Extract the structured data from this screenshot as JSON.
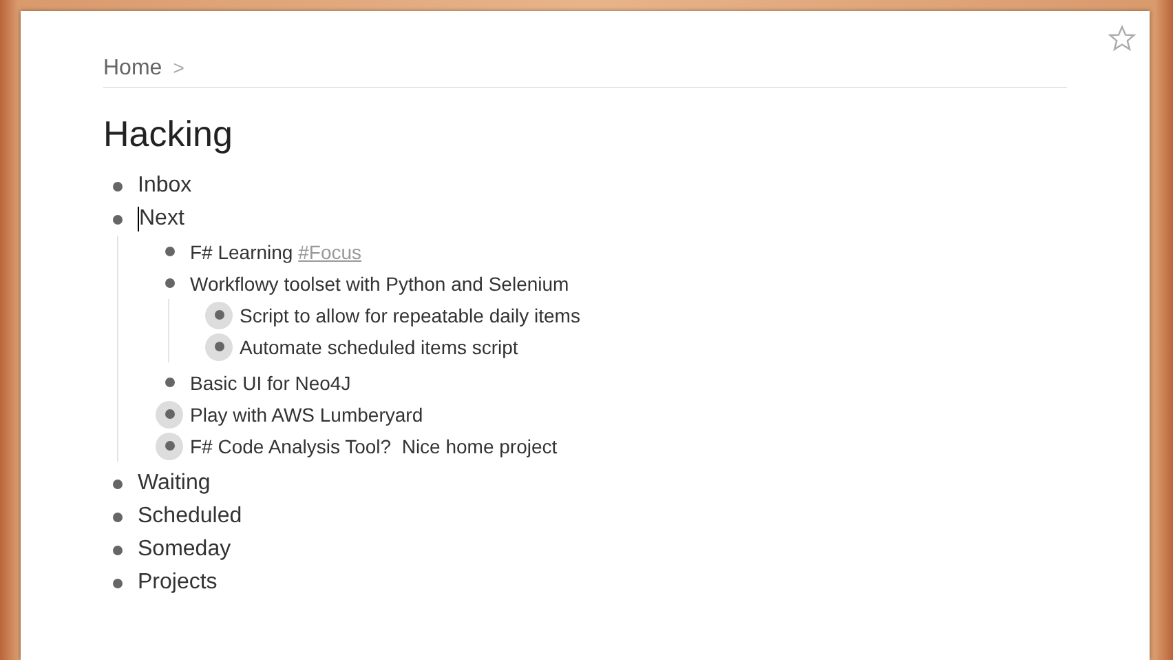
{
  "breadcrumb": [
    {
      "label": "Home"
    }
  ],
  "breadcrumb_separator": ">",
  "starred": false,
  "title": "Hacking",
  "items": [
    {
      "text": "Inbox",
      "collapsed": false,
      "editing": false
    },
    {
      "text": "Next",
      "collapsed": false,
      "editing": true,
      "children": [
        {
          "text": "F# Learning ",
          "tag": "#Focus",
          "collapsed": false,
          "editing": false
        },
        {
          "text": "Workflowy toolset with Python and Selenium",
          "collapsed": false,
          "editing": false,
          "children": [
            {
              "text": "Script to allow for repeatable daily items",
              "collapsed": true,
              "editing": false
            },
            {
              "text": "Automate scheduled items script",
              "collapsed": true,
              "editing": false
            }
          ]
        },
        {
          "text": "Basic UI for Neo4J",
          "collapsed": false,
          "editing": false
        },
        {
          "text": "Play with AWS Lumberyard",
          "collapsed": true,
          "editing": false
        },
        {
          "text": "F# Code Analysis Tool?  Nice home project",
          "collapsed": true,
          "editing": false
        }
      ]
    },
    {
      "text": "Waiting",
      "collapsed": false,
      "editing": false
    },
    {
      "text": "Scheduled",
      "collapsed": false,
      "editing": false
    },
    {
      "text": "Someday",
      "collapsed": false,
      "editing": false
    },
    {
      "text": "Projects",
      "collapsed": false,
      "editing": false
    }
  ]
}
